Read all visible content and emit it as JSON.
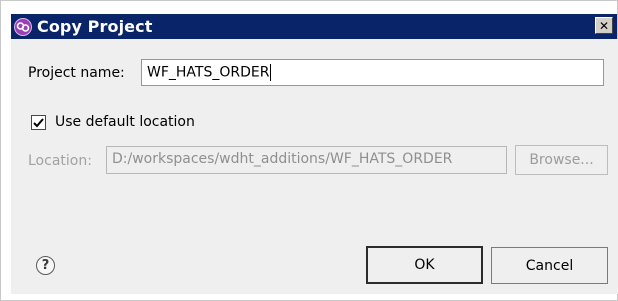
{
  "window": {
    "title": "Copy Project",
    "close_glyph": "✕",
    "icon": "copy-project-icon"
  },
  "form": {
    "project_name_label": "Project name:",
    "project_name_value": "WF_HATS_ORDER",
    "use_default_location_label": "Use default location",
    "use_default_location_checked": true,
    "location_label": "Location:",
    "location_value": "D:/workspaces/wdht_additions/WF_HATS_ORDER",
    "browse_label": "Browse..."
  },
  "footer": {
    "help_glyph": "?",
    "ok_label": "OK",
    "cancel_label": "Cancel"
  },
  "colors": {
    "titlebar": "#0a246a",
    "panel": "#efefef"
  }
}
